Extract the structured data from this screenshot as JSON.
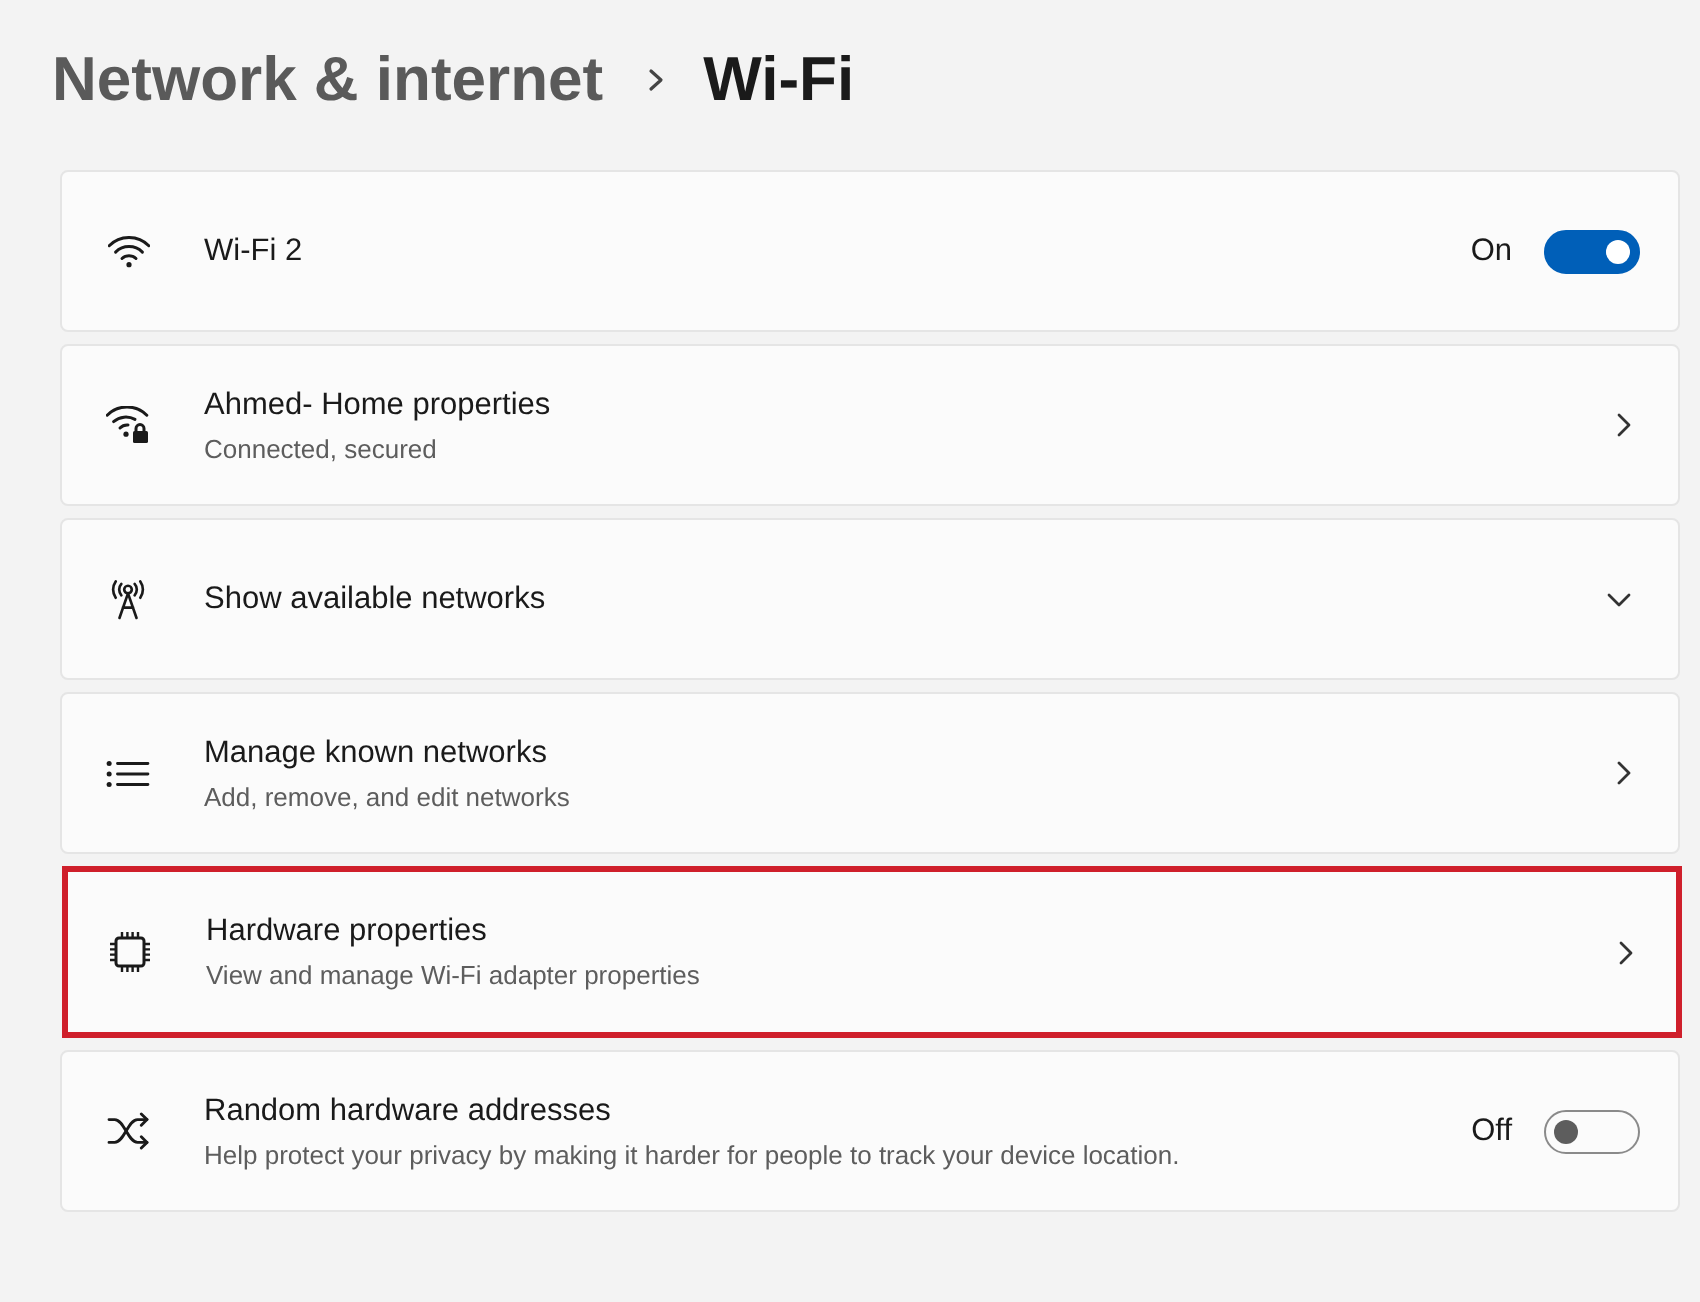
{
  "breadcrumb": {
    "parent": "Network & internet",
    "current": "Wi-Fi"
  },
  "items": [
    {
      "kind": "toggle",
      "title": "Wi-Fi 2",
      "state_label": "On",
      "on": true,
      "highlighted": false
    },
    {
      "kind": "link",
      "title": "Ahmed- Home properties",
      "subtitle": "Connected, secured",
      "highlighted": false
    },
    {
      "kind": "expand",
      "title": "Show available networks",
      "expanded": false,
      "highlighted": false
    },
    {
      "kind": "link",
      "title": "Manage known networks",
      "subtitle": "Add, remove, and edit networks",
      "highlighted": false
    },
    {
      "kind": "link",
      "title": "Hardware properties",
      "subtitle": "View and manage Wi-Fi adapter properties",
      "highlighted": true
    },
    {
      "kind": "toggle",
      "title": "Random hardware addresses",
      "subtitle": "Help protect your privacy by making it harder for people to track your device location.",
      "state_label": "Off",
      "on": false,
      "highlighted": false
    }
  ]
}
